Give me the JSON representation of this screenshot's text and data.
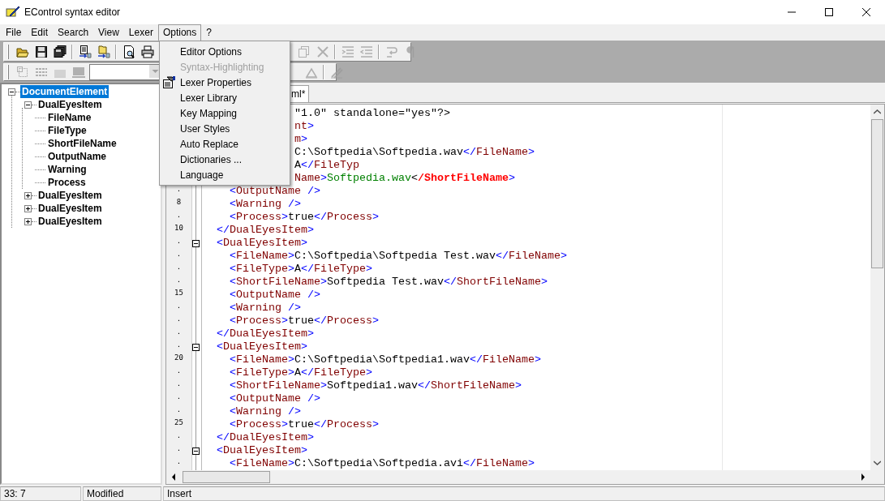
{
  "window": {
    "title": "EControl syntax editor"
  },
  "menu_bar": [
    {
      "label": "File",
      "selected": false
    },
    {
      "label": "Edit",
      "selected": false
    },
    {
      "label": "Search",
      "selected": false
    },
    {
      "label": "View",
      "selected": false
    },
    {
      "label": "Lexer",
      "selected": false
    },
    {
      "label": "Options",
      "selected": true
    },
    {
      "label": "?",
      "selected": false
    }
  ],
  "toolbar_1": {
    "left": [
      {
        "kind": "button",
        "disabled": false
      },
      {
        "kind": "button",
        "disabled": false
      },
      {
        "kind": "button",
        "disabled": false
      },
      {
        "kind": "separator"
      },
      {
        "kind": "button",
        "disabled": false
      },
      {
        "kind": "button",
        "disabled": false
      },
      {
        "kind": "separator"
      },
      {
        "kind": "button",
        "disabled": false
      },
      {
        "kind": "button",
        "disabled": false
      }
    ],
    "right": [
      {
        "kind": "button",
        "disabled": true
      },
      {
        "kind": "button",
        "disabled": true
      },
      {
        "kind": "separator"
      },
      {
        "kind": "button",
        "disabled": true
      },
      {
        "kind": "button",
        "disabled": true
      },
      {
        "kind": "separator"
      },
      {
        "kind": "button",
        "disabled": true
      },
      {
        "kind": "button",
        "disabled": true
      }
    ]
  },
  "toolbar_2": {
    "left": [
      {
        "kind": "button",
        "disabled": true
      },
      {
        "kind": "button",
        "disabled": true
      },
      {
        "kind": "button",
        "disabled": true
      },
      {
        "kind": "button",
        "disabled": true
      },
      {
        "kind": "combo"
      }
    ],
    "right": [
      {
        "kind": "button",
        "disabled": true
      },
      {
        "kind": "separator"
      },
      {
        "kind": "button",
        "disabled": true
      }
    ]
  },
  "options_menu": [
    {
      "label": "Editor Options",
      "disabled": false,
      "icon": false
    },
    {
      "label": "Syntax-Highlighting",
      "disabled": true,
      "icon": false
    },
    {
      "label": "Lexer Properties",
      "disabled": false,
      "icon": true
    },
    {
      "label": "Lexer Library",
      "disabled": false,
      "icon": false
    },
    {
      "label": "Key Mapping",
      "disabled": false,
      "icon": false
    },
    {
      "label": "User Styles",
      "disabled": false,
      "icon": false
    },
    {
      "label": "Auto Replace",
      "disabled": false,
      "icon": false
    },
    {
      "label": "Dictionaries ...",
      "disabled": false,
      "icon": false
    },
    {
      "label": "Language",
      "disabled": false,
      "icon": false
    }
  ],
  "tree": [
    {
      "label": "DocumentElement",
      "selected": true,
      "expanded": true,
      "children": [
        {
          "label": "DualEyesItem",
          "selected": false,
          "expanded": true,
          "children": [
            {
              "label": "FileName",
              "selected": false
            },
            {
              "label": "FileType",
              "selected": false
            },
            {
              "label": "ShortFileName",
              "selected": false
            },
            {
              "label": "OutputName",
              "selected": false
            },
            {
              "label": "Warning",
              "selected": false
            },
            {
              "label": "Process",
              "selected": false
            }
          ]
        },
        {
          "label": "DualEyesItem",
          "selected": false,
          "expanded": false
        },
        {
          "label": "DualEyesItem",
          "selected": false,
          "expanded": false
        },
        {
          "label": "DualEyesItem",
          "selected": false,
          "expanded": false
        }
      ]
    }
  ],
  "tab": {
    "label": "ml*",
    "selected": true
  },
  "editor": {
    "lines": [
      {
        "covered": true,
        "fold": false,
        "tokens": [
          {
            "kind": "text",
            "text": "\"1.0\" standalone=\"yes\"?>"
          }
        ]
      },
      {
        "covered": true,
        "fold": false,
        "tokens": [
          {
            "kind": "tag",
            "text": "nt"
          },
          {
            "kind": "bracket",
            "text": ">"
          }
        ]
      },
      {
        "covered": true,
        "fold": false,
        "tokens": [
          {
            "kind": "tag",
            "text": "m"
          },
          {
            "kind": "bracket",
            "text": ">"
          }
        ]
      },
      {
        "covered": true,
        "fold": false,
        "tokens": [
          {
            "kind": "text",
            "text": "C:\\Softpedia\\Softpedia.wav"
          },
          {
            "kind": "bracket",
            "text": "</"
          },
          {
            "kind": "tag",
            "text": "FileName"
          },
          {
            "kind": "bracket",
            "text": ">"
          }
        ]
      },
      {
        "covered": true,
        "fold": false,
        "tokens": [
          {
            "kind": "text",
            "text": "A"
          },
          {
            "kind": "bracket",
            "text": "</"
          },
          {
            "kind": "tag",
            "text": "FileTyp"
          }
        ]
      },
      {
        "covered": true,
        "fold": false,
        "tokens": [
          {
            "kind": "tag",
            "text": "Name"
          },
          {
            "kind": "bracket",
            "text": ">"
          },
          {
            "kind": "string",
            "text": "Softpedia.wav"
          },
          {
            "kind": "text",
            "text": "<"
          },
          {
            "kind": "error",
            "text": "/ShortFileName"
          },
          {
            "kind": "bracket",
            "text": ">"
          }
        ]
      },
      {
        "gutter": ".",
        "fold": false,
        "tokens": [
          {
            "kind": "bracket",
            "text": "    <"
          },
          {
            "kind": "tag",
            "text": "OutputName"
          },
          {
            "kind": "bracket",
            "text": " />"
          }
        ]
      },
      {
        "gutter": "8",
        "fold": false,
        "tokens": [
          {
            "kind": "bracket",
            "text": "    <"
          },
          {
            "kind": "tag",
            "text": "Warning"
          },
          {
            "kind": "bracket",
            "text": " />"
          }
        ]
      },
      {
        "gutter": ".",
        "fold": false,
        "tokens": [
          {
            "kind": "bracket",
            "text": "    <"
          },
          {
            "kind": "tag",
            "text": "Process"
          },
          {
            "kind": "bracket",
            "text": ">"
          },
          {
            "kind": "text",
            "text": "true"
          },
          {
            "kind": "bracket",
            "text": "</"
          },
          {
            "kind": "tag",
            "text": "Process"
          },
          {
            "kind": "bracket",
            "text": ">"
          }
        ]
      },
      {
        "gutter": "10",
        "fold": false,
        "tokens": [
          {
            "kind": "bracket",
            "text": "  </"
          },
          {
            "kind": "tag",
            "text": "DualEyesItem"
          },
          {
            "kind": "bracket",
            "text": ">"
          }
        ]
      },
      {
        "gutter": ".",
        "fold": true,
        "tokens": [
          {
            "kind": "bracket",
            "text": "  <"
          },
          {
            "kind": "tag",
            "text": "DualEyesItem"
          },
          {
            "kind": "bracket",
            "text": ">"
          }
        ]
      },
      {
        "gutter": ".",
        "fold": false,
        "tokens": [
          {
            "kind": "bracket",
            "text": "    <"
          },
          {
            "kind": "tag",
            "text": "FileName"
          },
          {
            "kind": "bracket",
            "text": ">"
          },
          {
            "kind": "text",
            "text": "C:\\Softpedia\\Softpedia Test.wav"
          },
          {
            "kind": "bracket",
            "text": "</"
          },
          {
            "kind": "tag",
            "text": "FileName"
          },
          {
            "kind": "bracket",
            "text": ">"
          }
        ]
      },
      {
        "gutter": ".",
        "fold": false,
        "tokens": [
          {
            "kind": "bracket",
            "text": "    <"
          },
          {
            "kind": "tag",
            "text": "FileType"
          },
          {
            "kind": "bracket",
            "text": ">"
          },
          {
            "kind": "text",
            "text": "A"
          },
          {
            "kind": "bracket",
            "text": "</"
          },
          {
            "kind": "tag",
            "text": "FileType"
          },
          {
            "kind": "bracket",
            "text": ">"
          }
        ]
      },
      {
        "gutter": ".",
        "fold": false,
        "tokens": [
          {
            "kind": "bracket",
            "text": "    <"
          },
          {
            "kind": "tag",
            "text": "ShortFileName"
          },
          {
            "kind": "bracket",
            "text": ">"
          },
          {
            "kind": "text",
            "text": "Softpedia Test.wav"
          },
          {
            "kind": "bracket",
            "text": "</"
          },
          {
            "kind": "tag",
            "text": "ShortFileName"
          },
          {
            "kind": "bracket",
            "text": ">"
          }
        ]
      },
      {
        "gutter": "15",
        "fold": false,
        "tokens": [
          {
            "kind": "bracket",
            "text": "    <"
          },
          {
            "kind": "tag",
            "text": "OutputName"
          },
          {
            "kind": "bracket",
            "text": " />"
          }
        ]
      },
      {
        "gutter": ".",
        "fold": false,
        "tokens": [
          {
            "kind": "bracket",
            "text": "    <"
          },
          {
            "kind": "tag",
            "text": "Warning"
          },
          {
            "kind": "bracket",
            "text": " />"
          }
        ]
      },
      {
        "gutter": ".",
        "fold": false,
        "tokens": [
          {
            "kind": "bracket",
            "text": "    <"
          },
          {
            "kind": "tag",
            "text": "Process"
          },
          {
            "kind": "bracket",
            "text": ">"
          },
          {
            "kind": "text",
            "text": "true"
          },
          {
            "kind": "bracket",
            "text": "</"
          },
          {
            "kind": "tag",
            "text": "Process"
          },
          {
            "kind": "bracket",
            "text": ">"
          }
        ]
      },
      {
        "gutter": ".",
        "fold": false,
        "tokens": [
          {
            "kind": "bracket",
            "text": "  </"
          },
          {
            "kind": "tag",
            "text": "DualEyesItem"
          },
          {
            "kind": "bracket",
            "text": ">"
          }
        ]
      },
      {
        "gutter": ".",
        "fold": true,
        "tokens": [
          {
            "kind": "bracket",
            "text": "  <"
          },
          {
            "kind": "tag",
            "text": "DualEyesItem"
          },
          {
            "kind": "bracket",
            "text": ">"
          }
        ]
      },
      {
        "gutter": "20",
        "fold": false,
        "tokens": [
          {
            "kind": "bracket",
            "text": "    <"
          },
          {
            "kind": "tag",
            "text": "FileName"
          },
          {
            "kind": "bracket",
            "text": ">"
          },
          {
            "kind": "text",
            "text": "C:\\Softpedia\\Softpedia1.wav"
          },
          {
            "kind": "bracket",
            "text": "</"
          },
          {
            "kind": "tag",
            "text": "FileName"
          },
          {
            "kind": "bracket",
            "text": ">"
          }
        ]
      },
      {
        "gutter": ".",
        "fold": false,
        "tokens": [
          {
            "kind": "bracket",
            "text": "    <"
          },
          {
            "kind": "tag",
            "text": "FileType"
          },
          {
            "kind": "bracket",
            "text": ">"
          },
          {
            "kind": "text",
            "text": "A"
          },
          {
            "kind": "bracket",
            "text": "</"
          },
          {
            "kind": "tag",
            "text": "FileType"
          },
          {
            "kind": "bracket",
            "text": ">"
          }
        ]
      },
      {
        "gutter": ".",
        "fold": false,
        "tokens": [
          {
            "kind": "bracket",
            "text": "    <"
          },
          {
            "kind": "tag",
            "text": "ShortFileName"
          },
          {
            "kind": "bracket",
            "text": ">"
          },
          {
            "kind": "text",
            "text": "Softpedia1.wav"
          },
          {
            "kind": "bracket",
            "text": "</"
          },
          {
            "kind": "tag",
            "text": "ShortFileName"
          },
          {
            "kind": "bracket",
            "text": ">"
          }
        ]
      },
      {
        "gutter": ".",
        "fold": false,
        "tokens": [
          {
            "kind": "bracket",
            "text": "    <"
          },
          {
            "kind": "tag",
            "text": "OutputName"
          },
          {
            "kind": "bracket",
            "text": " />"
          }
        ]
      },
      {
        "gutter": ".",
        "fold": false,
        "tokens": [
          {
            "kind": "bracket",
            "text": "    <"
          },
          {
            "kind": "tag",
            "text": "Warning"
          },
          {
            "kind": "bracket",
            "text": " />"
          }
        ]
      },
      {
        "gutter": "25",
        "fold": false,
        "tokens": [
          {
            "kind": "bracket",
            "text": "    <"
          },
          {
            "kind": "tag",
            "text": "Process"
          },
          {
            "kind": "bracket",
            "text": ">"
          },
          {
            "kind": "text",
            "text": "true"
          },
          {
            "kind": "bracket",
            "text": "</"
          },
          {
            "kind": "tag",
            "text": "Process"
          },
          {
            "kind": "bracket",
            "text": ">"
          }
        ]
      },
      {
        "gutter": ".",
        "fold": false,
        "tokens": [
          {
            "kind": "bracket",
            "text": "  </"
          },
          {
            "kind": "tag",
            "text": "DualEyesItem"
          },
          {
            "kind": "bracket",
            "text": ">"
          }
        ]
      },
      {
        "gutter": ".",
        "fold": true,
        "tokens": [
          {
            "kind": "bracket",
            "text": "  <"
          },
          {
            "kind": "tag",
            "text": "DualEyesItem"
          },
          {
            "kind": "bracket",
            "text": ">"
          }
        ]
      },
      {
        "gutter": ".",
        "fold": false,
        "tokens": [
          {
            "kind": "bracket",
            "text": "    <"
          },
          {
            "kind": "tag",
            "text": "FileName"
          },
          {
            "kind": "bracket",
            "text": ">"
          },
          {
            "kind": "text",
            "text": "C:\\Softpedia\\Softpedia.avi"
          },
          {
            "kind": "bracket",
            "text": "</"
          },
          {
            "kind": "tag",
            "text": "FileName"
          },
          {
            "kind": "bracket",
            "text": ">"
          }
        ]
      }
    ]
  },
  "status_bar": [
    "33: 7",
    "Modified",
    "Insert"
  ]
}
